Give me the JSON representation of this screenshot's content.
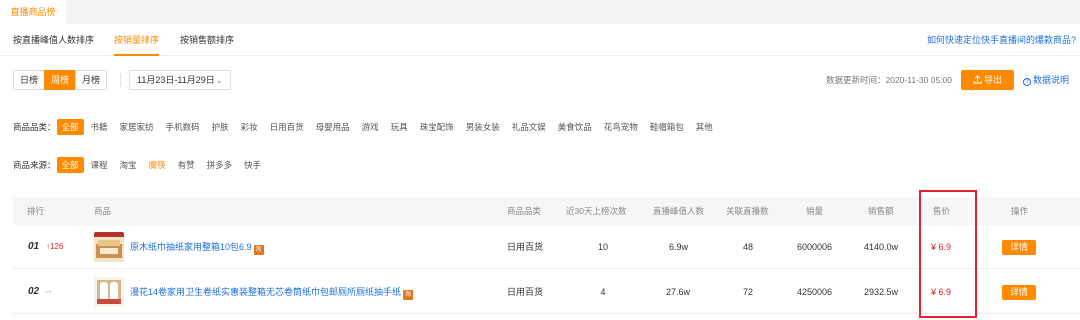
{
  "top_tab": "直播商品榜",
  "subtabs": [
    "按直播峰值人数排序",
    "按销量排序",
    "按销售额排序"
  ],
  "active_subtab": 1,
  "help_link": "如何快速定位快手直播间的爆款商品?",
  "periods": [
    "日榜",
    "周榜",
    "月榜"
  ],
  "active_period": 1,
  "date_range": "11月23日-11月29日",
  "update_label": "数据更新时间：2020-11-30 05:00",
  "export_label": "导出",
  "data_help_label": "数据说明",
  "category_filter": {
    "label": "商品品类：",
    "options": [
      "全部",
      "书籍",
      "家居家纺",
      "手机数码",
      "护肤",
      "彩妆",
      "日用百货",
      "母婴用品",
      "游戏",
      "玩具",
      "珠宝配饰",
      "男装女装",
      "礼品文娱",
      "美食饮品",
      "花鸟宠物",
      "鞋帽箱包",
      "其他"
    ]
  },
  "source_filter": {
    "label": "商品来源：",
    "options": [
      "全部",
      "课程",
      "淘宝",
      "魔筷",
      "有赞",
      "拼多多",
      "快手"
    ]
  },
  "table": {
    "headers": [
      "排行",
      "商品",
      "商品品类",
      "近30天上榜次数",
      "直播峰值人数",
      "关联直播数",
      "销量",
      "销售额",
      "售价",
      "操作"
    ],
    "rows": [
      {
        "rank": "01",
        "change": "↑126",
        "title": "原木纸巾抽纸家用整箱10包6.9",
        "badge": "淘",
        "category": "日用百货",
        "appearances": "10",
        "peak_viewers": "6.9w",
        "linked_streams": "48",
        "sales": "6000006",
        "revenue": "4140.0w",
        "price": "¥ 6.9",
        "action": "详情"
      },
      {
        "rank": "02",
        "change": "--",
        "title": "漫花14卷家用卫生卷纸实惠装整箱无芯卷筒纸巾包邮厕所厕纸抽手纸",
        "badge": "淘",
        "category": "日用百货",
        "appearances": "4",
        "peak_viewers": "27.6w",
        "linked_streams": "72",
        "sales": "4250006",
        "revenue": "2932.5w",
        "price": "¥ 6.9",
        "action": "详情"
      }
    ]
  },
  "colors": {
    "accent": "#ff8a00",
    "link": "#1e6fd9",
    "price": "#e02020",
    "highlight_border": "#e8212f"
  }
}
